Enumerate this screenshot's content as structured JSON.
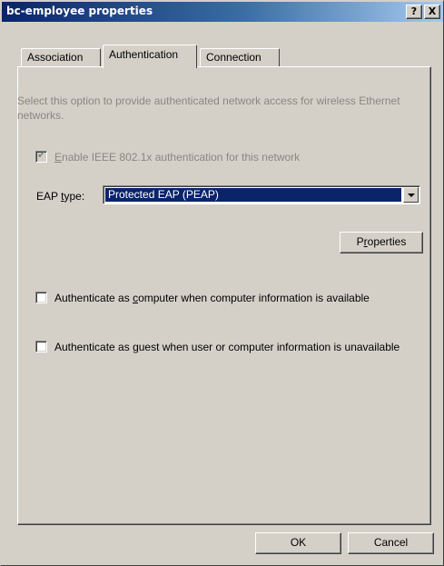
{
  "window": {
    "title": "bc-employee properties",
    "help_label": "?",
    "close_label": "X"
  },
  "tabs": [
    {
      "label": "Association",
      "selected": false
    },
    {
      "label": "Authentication",
      "selected": true
    },
    {
      "label": "Connection",
      "selected": false
    }
  ],
  "auth": {
    "description": "Select this option to provide authenticated network access for wireless Ethernet networks.",
    "enable_8021x": {
      "label_pre": "",
      "label_key": "E",
      "label_post": "nable IEEE 802.1x authentication for this network",
      "checked": true,
      "enabled": false
    },
    "eap_type": {
      "label_pre": "EAP ",
      "label_key": "t",
      "label_post": "ype:",
      "selected_value": "Protected EAP (PEAP)"
    },
    "properties_button": {
      "label_pre": "P",
      "label_key": "r",
      "label_post": "operties"
    },
    "auth_as_computer": {
      "label_pre": "Authenticate as ",
      "label_key": "c",
      "label_post": "omputer when computer information is available",
      "checked": false
    },
    "auth_as_guest": {
      "label_pre": "Authenticate as ",
      "label_key": "g",
      "label_post": "uest when user or computer information is unavailable",
      "checked": false
    }
  },
  "footer": {
    "ok_label": "OK",
    "cancel_label": "Cancel"
  }
}
